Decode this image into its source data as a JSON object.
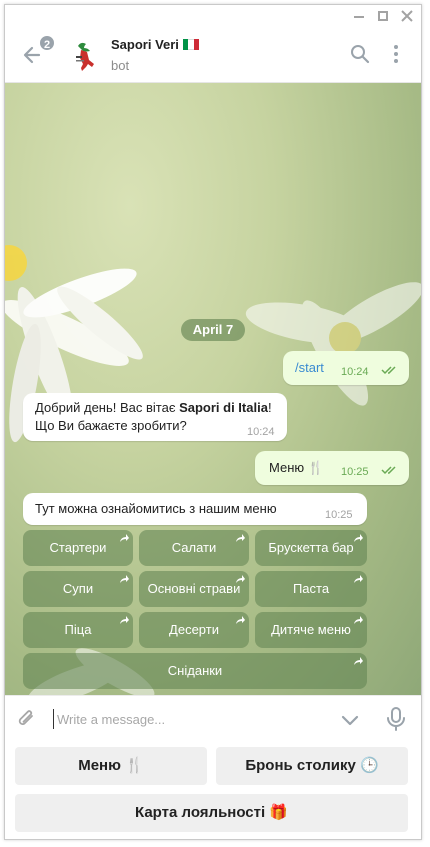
{
  "header": {
    "unread_badge": "2",
    "title": "Sapori Veri",
    "subtitle": "bot"
  },
  "chat": {
    "date": "April 7",
    "messages": [
      {
        "text": "/start",
        "time": "10:24"
      },
      {
        "text_pre": "Добрий день! Вас вітає ",
        "text_bold": "Sapori di Italia",
        "text_post": "! Що Ви бажаєте зробити?",
        "time": "10:24"
      },
      {
        "text": "Меню 🍴",
        "time": "10:25"
      },
      {
        "text": "Тут можна ознайомитись з нашим меню",
        "time": "10:25"
      }
    ],
    "inline_keyboard": [
      "Стартери",
      "Салати",
      "Брускетта бар",
      "Супи",
      "Основні страви",
      "Паста",
      "Піца",
      "Десерти",
      "Дитяче меню",
      "Сніданки"
    ]
  },
  "input": {
    "placeholder": "Write a message..."
  },
  "reply_keyboard": {
    "menu": "Меню 🍴",
    "booking": "Бронь столику 🕒",
    "loyalty": "Карта лояльності 🎁"
  },
  "colors": {
    "accent_green": "#6aaa55",
    "outgoing_bubble": "#effdde",
    "flag": [
      "#009246",
      "#ffffff",
      "#ce2b37"
    ]
  }
}
